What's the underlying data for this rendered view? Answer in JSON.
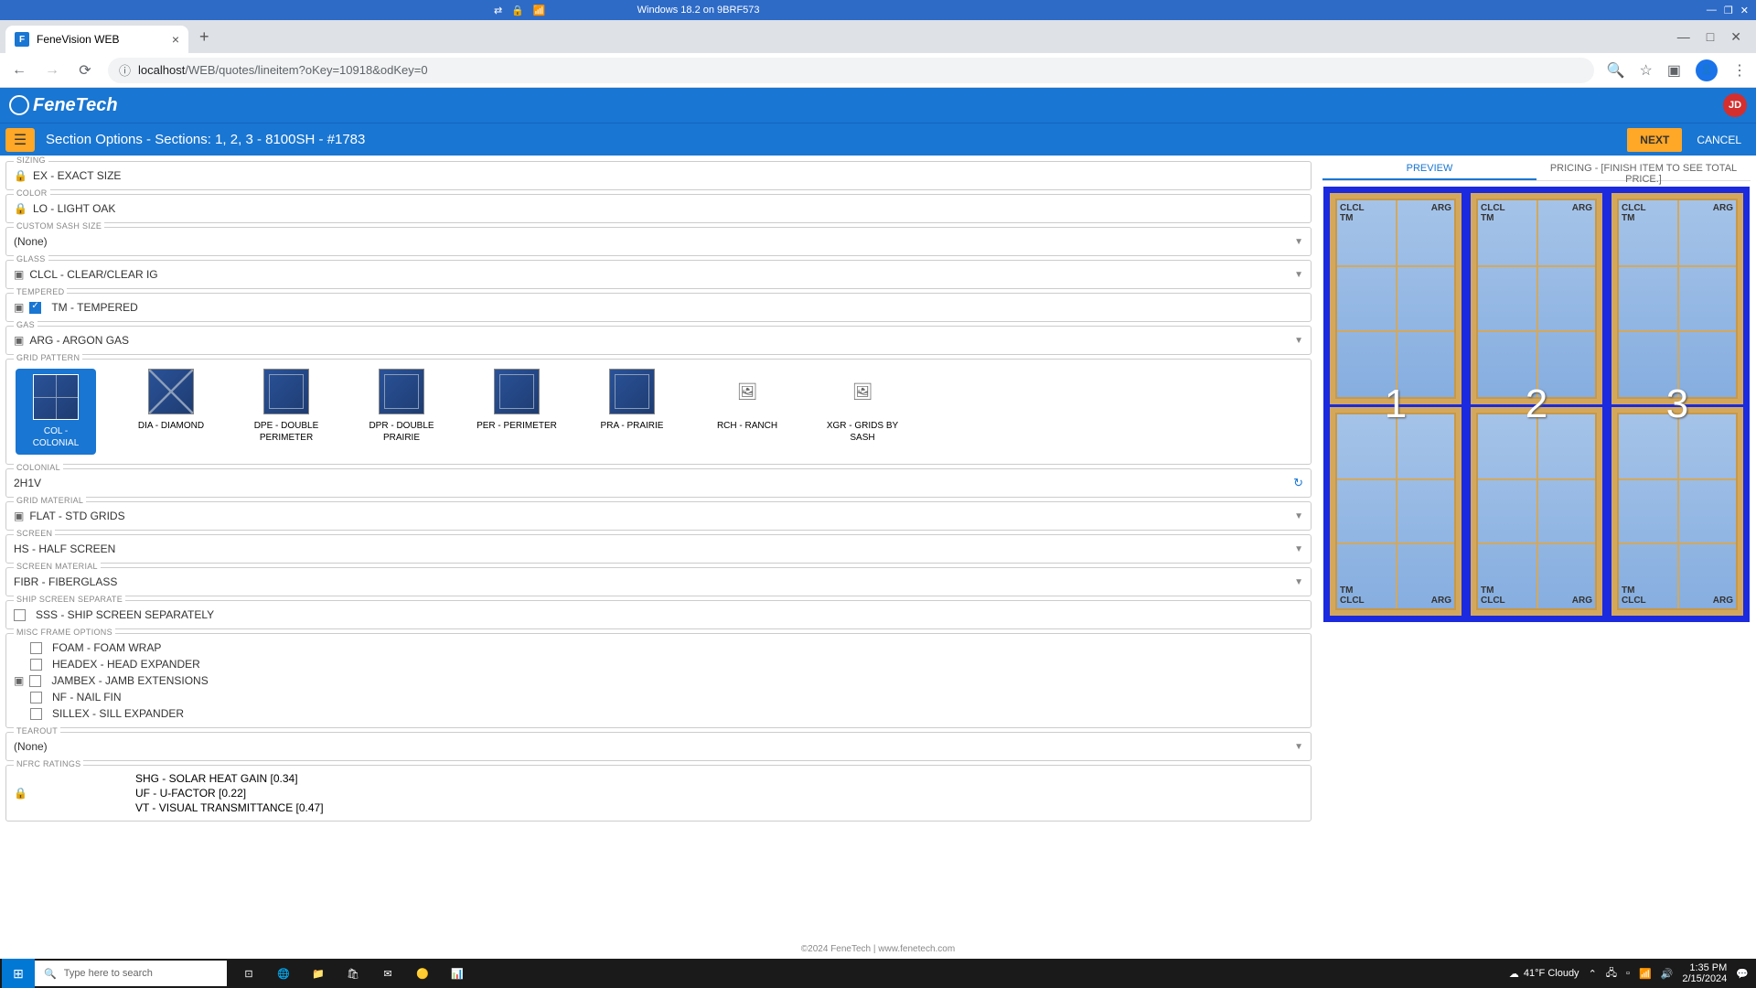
{
  "vm": {
    "title": "Windows 18.2 on 9BRF573"
  },
  "browser": {
    "tab_title": "FeneVision WEB",
    "url_host": "localhost",
    "url_path": "/WEB/quotes/lineitem?oKey=10918&odKey=0"
  },
  "app": {
    "brand": "FeneTech",
    "avatar": "JD"
  },
  "toolbar": {
    "title": "Section Options - Sections: 1, 2, 3 - 8100SH - #1783",
    "next": "NEXT",
    "cancel": "CANCEL"
  },
  "fields": {
    "sizing": {
      "label": "SIZING",
      "value": "EX - EXACT SIZE"
    },
    "color": {
      "label": "COLOR",
      "value": "LO - LIGHT OAK"
    },
    "custom_sash": {
      "label": "CUSTOM SASH SIZE",
      "value": "(None)"
    },
    "glass": {
      "label": "GLASS",
      "value": "CLCL - CLEAR/CLEAR IG"
    },
    "tempered": {
      "label": "TEMPERED",
      "value": "TM - TEMPERED"
    },
    "gas": {
      "label": "GAS",
      "value": "ARG - ARGON GAS"
    },
    "grid_pattern": {
      "label": "GRID PATTERN"
    },
    "colonial": {
      "label": "COLONIAL",
      "value": "2H1V"
    },
    "grid_material": {
      "label": "GRID MATERIAL",
      "value": "FLAT - STD GRIDS"
    },
    "screen": {
      "label": "SCREEN",
      "value": "HS - HALF SCREEN"
    },
    "screen_material": {
      "label": "SCREEN MATERIAL",
      "value": "FIBR - FIBERGLASS"
    },
    "ship_screen": {
      "label": "SHIP SCREEN SEPARATE",
      "value": "SSS - SHIP SCREEN SEPARATELY"
    },
    "misc_frame": {
      "label": "MISC FRAME OPTIONS"
    },
    "tearout": {
      "label": "TEAROUT",
      "value": "(None)"
    },
    "nfrc": {
      "label": "NFRC RATINGS"
    }
  },
  "grid_patterns": [
    {
      "code": "COL",
      "label": "COL - COLONIAL"
    },
    {
      "code": "DIA",
      "label": "DIA - DIAMOND"
    },
    {
      "code": "DPE",
      "label": "DPE - DOUBLE PERIMETER"
    },
    {
      "code": "DPR",
      "label": "DPR - DOUBLE PRAIRIE"
    },
    {
      "code": "PER",
      "label": "PER - PERIMETER"
    },
    {
      "code": "PRA",
      "label": "PRA - PRAIRIE"
    },
    {
      "code": "RCH",
      "label": "RCH - RANCH"
    },
    {
      "code": "XGR",
      "label": "XGR - GRIDS BY SASH"
    }
  ],
  "misc_options": [
    "FOAM - FOAM WRAP",
    "HEADEX - HEAD EXPANDER",
    "JAMBEX - JAMB EXTENSIONS",
    "NF - NAIL FIN",
    "SILLEX - SILL EXPANDER"
  ],
  "nfrc_ratings": [
    "SHG - SOLAR HEAT GAIN [0.34]",
    "UF - U-FACTOR [0.22]",
    "VT - VISUAL TRANSMITTANCE [0.47]"
  ],
  "right_tabs": {
    "preview": "PREVIEW",
    "pricing": "PRICING - [FINISH ITEM TO SEE TOTAL PRICE.]"
  },
  "preview": {
    "top_label_left": "CLCL\nTM",
    "top_label_right": "ARG",
    "bot_label_left": "TM\nCLCL",
    "bot_label_right": "ARG",
    "numbers": [
      "1",
      "2",
      "3"
    ]
  },
  "footer": {
    "copyright": "©2024 FeneTech",
    "link": "www.fenetech.com"
  },
  "taskbar": {
    "search_placeholder": "Type here to search",
    "weather": "41°F Cloudy",
    "time": "1:35 PM",
    "date": "2/15/2024"
  }
}
